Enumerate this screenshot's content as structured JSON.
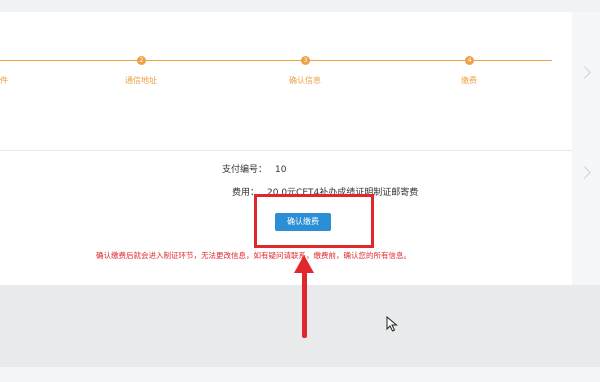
{
  "steps": [
    {
      "number": "",
      "label": "件"
    },
    {
      "number": "2",
      "label": "通信地址"
    },
    {
      "number": "3",
      "label": "确认信息"
    },
    {
      "number": "4",
      "label": "缴费"
    }
  ],
  "payment": {
    "order_label": "支付编号：",
    "order_value": "10",
    "fee_label": "费用：",
    "fee_value": "20.0元CET4补办成绩证明制证邮寄费"
  },
  "confirm_button": "确认缴费",
  "warning_text": "确认缴费后就会进入制证环节，无法更改信息，如有疑问请联系，缴费前，确认您的所有信息。",
  "colors": {
    "accent": "#f0a042",
    "button": "#2b8fd6",
    "annotation": "#e0282c"
  }
}
